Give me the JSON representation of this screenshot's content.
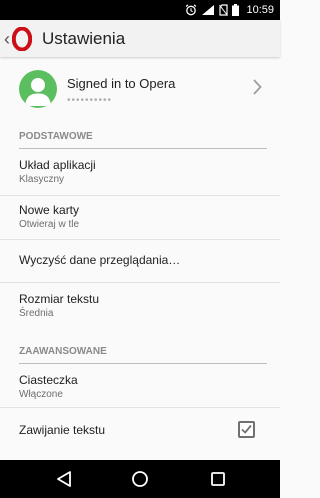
{
  "status_bar": {
    "time": "10:59"
  },
  "app_bar": {
    "title": "Ustawienia"
  },
  "account": {
    "title": "Signed in to Opera",
    "subtitle": "••••••••••"
  },
  "sections": {
    "basic": {
      "header": "PODSTAWOWE"
    },
    "advanced": {
      "header": "ZAAWANSOWANE"
    }
  },
  "items": {
    "layout": {
      "title": "Układ aplikacji",
      "value": "Klasyczny"
    },
    "new_tabs": {
      "title": "Nowe karty",
      "value": "Otwieraj w tle"
    },
    "clear_data": {
      "title": "Wyczyść dane przeglądania…"
    },
    "text_size": {
      "title": "Rozmiar tekstu",
      "value": "Średnia"
    },
    "cookies": {
      "title": "Ciasteczka",
      "value": "Włączone"
    },
    "text_wrap": {
      "title": "Zawijanie tekstu",
      "checked": true
    }
  },
  "colors": {
    "avatar": "#5cbf5f",
    "opera_red": "#cc0f16"
  }
}
